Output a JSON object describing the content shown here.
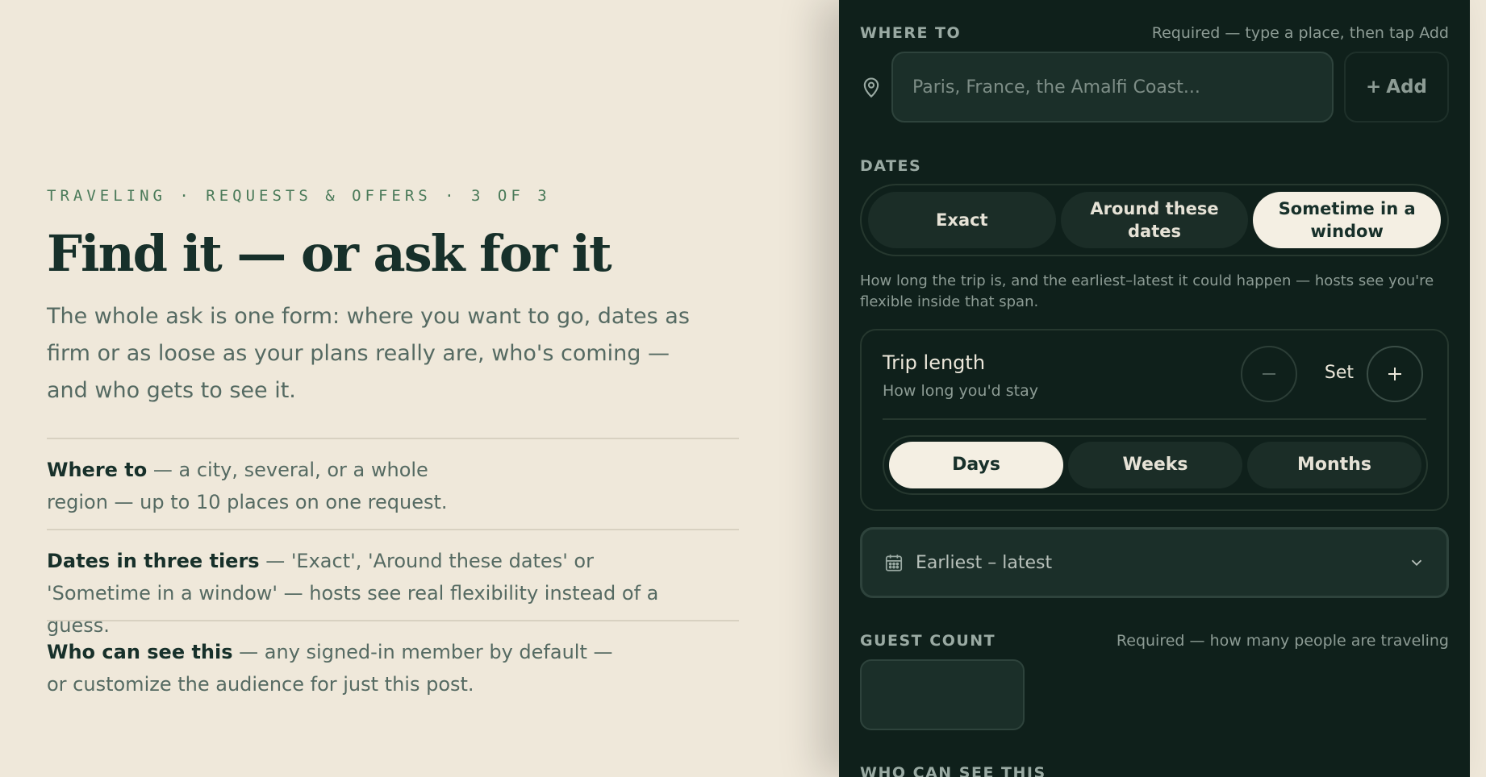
{
  "intro": {
    "eyebrow": "TRAVELING · REQUESTS & OFFERS · 3 OF 3",
    "title": "Find it — or ask for it",
    "lede": "The whole ask is one form: where you want to go, dates as firm or as loose as your plans really are, who's coming — and who gets to see it."
  },
  "features": [
    {
      "title": "Where to",
      "text": " — a city, several, or a whole region — up to 10 places on one request."
    },
    {
      "title": "Dates in three tiers",
      "text": " — 'Exact', 'Around these dates' or 'Sometime in a window' — hosts see real flexibility instead of a guess."
    },
    {
      "title": "Who can see this",
      "text": " — any signed-in member by default — or customize the audience for just this post."
    }
  ],
  "form": {
    "where": {
      "label": "WHERE TO",
      "hint": "Required — type a place, then tap Add",
      "placeholder": "Paris, France, the Amalfi Coast...",
      "add_label": "Add",
      "icon": "map-pin-icon"
    },
    "dates": {
      "label": "DATES",
      "options": [
        "Exact",
        "Around these dates",
        "Sometime in a window"
      ],
      "selected": "Sometime in a window",
      "help": "How long the trip is, and the earliest–latest it could happen — hosts see you're flexible inside that span."
    },
    "trip_length": {
      "title": "Trip length",
      "subtitle": "How long you'd stay",
      "value": "Set",
      "units": [
        "Days",
        "Weeks",
        "Months"
      ],
      "selected_unit": "Days"
    },
    "date_range": {
      "label": "Earliest – latest",
      "icon": "calendar-icon"
    },
    "guests": {
      "label": "GUEST COUNT",
      "hint": "Required — how many people are traveling",
      "value": ""
    },
    "visibility": {
      "label": "WHO CAN SEE THIS"
    }
  },
  "colors": {
    "page_bg": "#efe8da",
    "panel_bg": "#0f201b",
    "accent_green": "#4a7a59",
    "active_pill": "#f4efe3"
  }
}
